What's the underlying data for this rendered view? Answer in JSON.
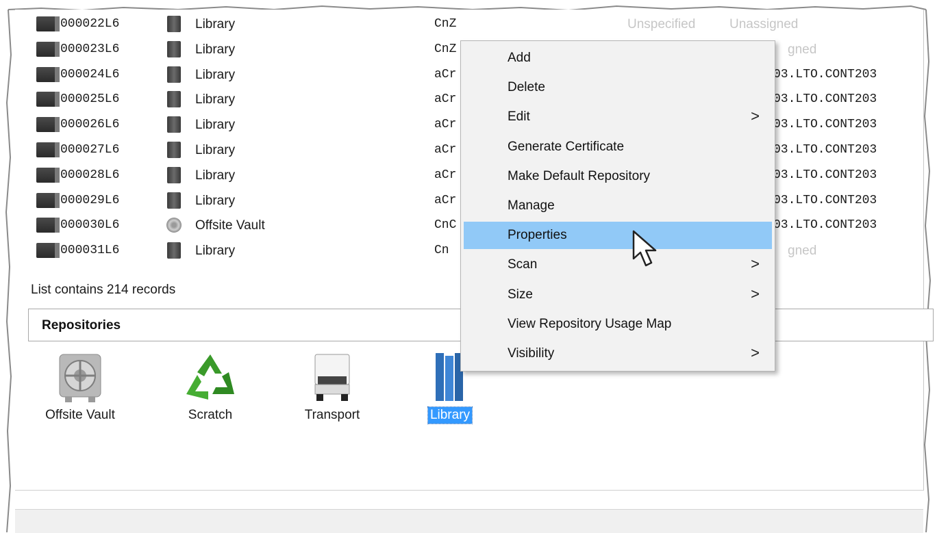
{
  "rows": [
    {
      "name": "000022L6",
      "location": "Library",
      "location_icon": "library-icon",
      "code": "CnZ",
      "col4": "Unspecified",
      "col5": "Unassigned",
      "faded": true
    },
    {
      "name": "000023L6",
      "location": "Library",
      "location_icon": "library-icon",
      "code": "CnZ",
      "col4": "",
      "col5": "gned",
      "faded": true
    },
    {
      "name": "000024L6",
      "location": "Library",
      "location_icon": "library-icon",
      "code": "aCr",
      "col4": "",
      "col5": "03.LTO.CONT203",
      "faded": false
    },
    {
      "name": "000025L6",
      "location": "Library",
      "location_icon": "library-icon",
      "code": "aCr",
      "col4": "",
      "col5": "03.LTO.CONT203",
      "faded": false
    },
    {
      "name": "000026L6",
      "location": "Library",
      "location_icon": "library-icon",
      "code": "aCr",
      "col4": "",
      "col5": "03.LTO.CONT203",
      "faded": false
    },
    {
      "name": "000027L6",
      "location": "Library",
      "location_icon": "library-icon",
      "code": "aCr",
      "col4": "",
      "col5": "03.LTO.CONT203",
      "faded": false
    },
    {
      "name": "000028L6",
      "location": "Library",
      "location_icon": "library-icon",
      "code": "aCr",
      "col4": "",
      "col5": "03.LTO.CONT203",
      "faded": false
    },
    {
      "name": "000029L6",
      "location": "Library",
      "location_icon": "library-icon",
      "code": "aCr",
      "col4": "",
      "col5": "03.LTO.CONT203",
      "faded": false
    },
    {
      "name": "000030L6",
      "location": "Offsite Vault",
      "location_icon": "vault-icon",
      "code": "CnC",
      "col4": "",
      "col5": "03.LTO.CONT203",
      "faded": false
    },
    {
      "name": "000031L6",
      "location": "Library",
      "location_icon": "library-icon",
      "code": "Cn",
      "col4": "",
      "col5": "gned",
      "faded": true
    }
  ],
  "status": {
    "records_text": "List contains 214 records"
  },
  "repositories": {
    "title": "Repositories",
    "items": [
      {
        "label": "Offsite Vault",
        "icon": "vault-door-icon",
        "selected": false
      },
      {
        "label": "Scratch",
        "icon": "recycle-icon",
        "selected": false
      },
      {
        "label": "Transport",
        "icon": "truck-icon",
        "selected": false
      },
      {
        "label": "Library",
        "icon": "library-server-icon",
        "selected": true
      }
    ]
  },
  "context_menu": {
    "items": [
      {
        "label": "Add",
        "submenu": false,
        "highlighted": false
      },
      {
        "label": "Delete",
        "submenu": false,
        "highlighted": false
      },
      {
        "label": "Edit",
        "submenu": true,
        "highlighted": false
      },
      {
        "label": "Generate Certificate",
        "submenu": false,
        "highlighted": false
      },
      {
        "label": "Make Default Repository",
        "submenu": false,
        "highlighted": false
      },
      {
        "label": "Manage",
        "submenu": false,
        "highlighted": false
      },
      {
        "label": "Properties",
        "submenu": false,
        "highlighted": true
      },
      {
        "label": "Scan",
        "submenu": true,
        "highlighted": false
      },
      {
        "label": "Size",
        "submenu": true,
        "highlighted": false
      },
      {
        "label": "View Repository Usage Map",
        "submenu": false,
        "highlighted": false
      },
      {
        "label": "Visibility",
        "submenu": true,
        "highlighted": false
      }
    ],
    "submenu_glyph": ">"
  },
  "colors": {
    "selection": "#3399ff",
    "menu_highlight": "#91c9f7",
    "menu_bg": "#f2f2f2"
  }
}
